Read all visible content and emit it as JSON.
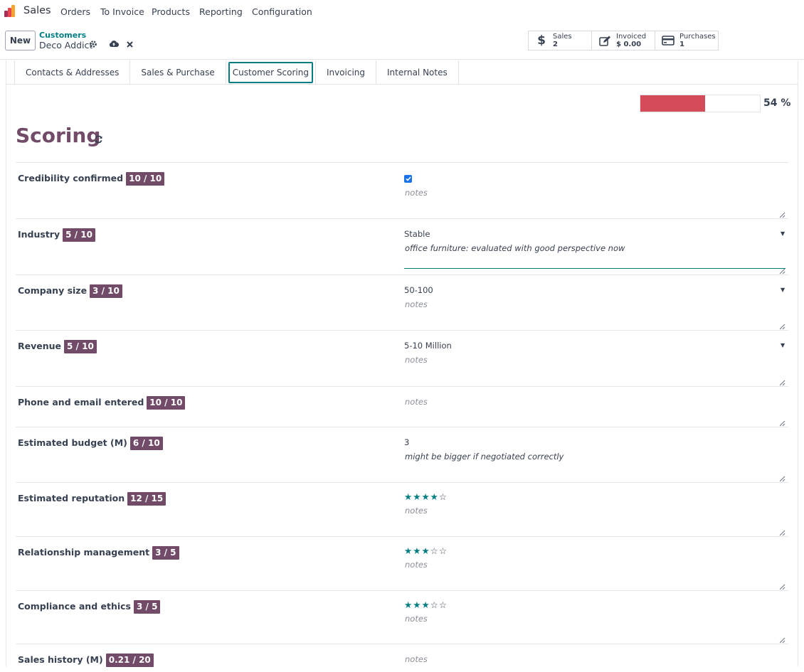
{
  "nav": {
    "app_name": "Sales",
    "menu": [
      "Orders",
      "To Invoice",
      "Products",
      "Reporting",
      "Configuration"
    ]
  },
  "control": {
    "new_label": "New",
    "breadcrumb_parent": "Customers",
    "breadcrumb_current": "Deco Addict",
    "smart_buttons": [
      {
        "label": "Sales",
        "value": "2",
        "icon": "dollar-icon"
      },
      {
        "label": "Invoiced",
        "value": "$ 0.00",
        "icon": "pencil-square-icon"
      },
      {
        "label": "Purchases",
        "value": "1",
        "icon": "credit-card-icon"
      }
    ]
  },
  "tabs": [
    "Contacts & Addresses",
    "Sales & Purchase",
    "Customer Scoring",
    "Invoicing",
    "Internal Notes"
  ],
  "active_tab": "Customer Scoring",
  "progress": {
    "value": 54,
    "label": "54 %",
    "color": "#d44c59"
  },
  "scoring": {
    "title": "Scoring",
    "rows": [
      {
        "label": "Credibility confirmed",
        "score": "10 / 10",
        "type": "checkbox",
        "checked": true,
        "notes": "notes"
      },
      {
        "label": "Industry",
        "score": "5 / 10",
        "type": "select",
        "value": "Stable",
        "notes": "office furniture: evaluated with good perspective now"
      },
      {
        "label": "Company size",
        "score": "3 / 10",
        "type": "select",
        "value": "50-100",
        "notes": "notes"
      },
      {
        "label": "Revenue",
        "score": "5 / 10",
        "type": "select",
        "value": "5-10 Million",
        "notes": "notes"
      },
      {
        "label": "Phone and email entered",
        "score": "10 / 10",
        "type": "none",
        "notes": "notes"
      },
      {
        "label": "Estimated budget (M)",
        "score": "6 / 10",
        "type": "number",
        "value": "3",
        "notes": "might be bigger if negotiated correctly"
      },
      {
        "label": "Estimated reputation",
        "score": "12 / 15",
        "type": "stars",
        "rating": 4,
        "max": 5,
        "notes": "notes"
      },
      {
        "label": "Relationship management",
        "score": "3 / 5",
        "type": "stars",
        "rating": 3,
        "max": 5,
        "notes": "notes"
      },
      {
        "label": "Compliance and ethics",
        "score": "3 / 5",
        "type": "stars",
        "rating": 3,
        "max": 5,
        "notes": "notes"
      },
      {
        "label": "Sales history (M)",
        "score": "0.21 / 20",
        "type": "none",
        "notes": "notes"
      }
    ]
  },
  "colors": {
    "brand": "#714b67",
    "accent": "#017e84",
    "progress_fill": "#d44c59"
  }
}
